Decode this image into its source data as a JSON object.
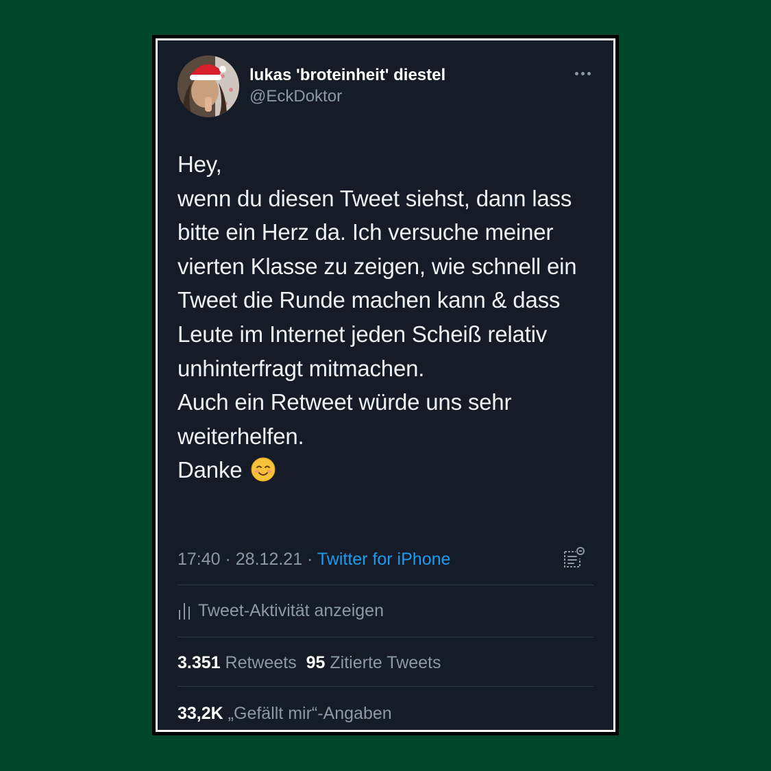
{
  "user": {
    "display_name": "lukas 'broteinheit' diestel",
    "handle": "@EckDoktor"
  },
  "tweet": {
    "text": "Hey,\nwenn du diesen Tweet siehst, dann lass bitte ein Herz da. Ich versuche meiner vierten Klasse zu zeigen, wie schnell ein Tweet die Runde machen kann & dass Leute im Internet jeden Scheiß relativ unhinterfragt mitmachen.\nAuch ein Retweet würde uns sehr weiterhelfen.\nDanke",
    "emoji": "smiling-face-emoji"
  },
  "meta": {
    "time": "17:40",
    "separator_1": " · ",
    "date": "28.12.21",
    "separator_2": " · ",
    "source": "Twitter for iPhone"
  },
  "activity": {
    "label": "Tweet-Aktivität anzeigen"
  },
  "stats": {
    "retweets_count": "3.351",
    "retweets_label": "Retweets",
    "quotes_count": "95",
    "quotes_label": "Zitierte Tweets",
    "likes_count": "33,2K",
    "likes_label": "„Gefällt mir“-Angaben"
  },
  "colors": {
    "page_background": "#00462b",
    "card_background": "#151c28",
    "text_primary": "#eef1f4",
    "text_secondary": "#8b98a5",
    "link": "#1d9bf0"
  }
}
